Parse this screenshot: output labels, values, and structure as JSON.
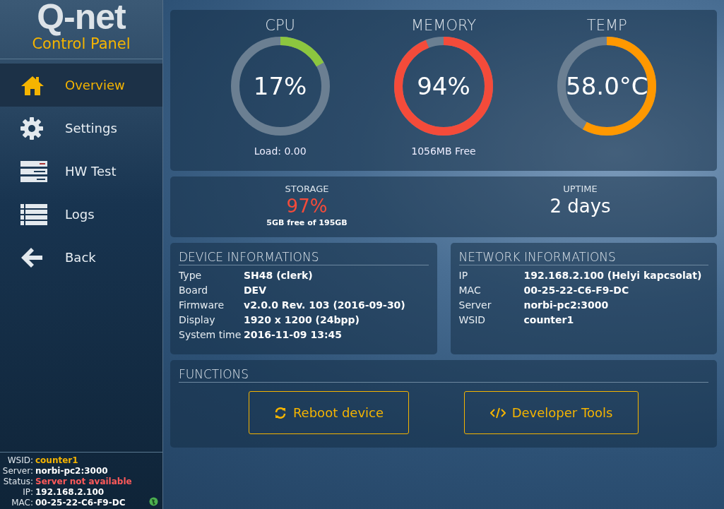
{
  "logo": {
    "brand": "Q-net",
    "subtitle": "Control Panel"
  },
  "nav": [
    {
      "label": "Overview",
      "kind": "home",
      "selected": true
    },
    {
      "label": "Settings",
      "kind": "gear",
      "selected": false
    },
    {
      "label": "HW Test",
      "kind": "server",
      "selected": false
    },
    {
      "label": "Logs",
      "kind": "list",
      "selected": false
    },
    {
      "label": "Back",
      "kind": "back",
      "selected": false
    }
  ],
  "status_info": [
    {
      "label": "WSID:",
      "value": "counter1",
      "color": "#f5b400"
    },
    {
      "label": "Server:",
      "value": "norbi-pc2:3000",
      "color": "#ffffff"
    },
    {
      "label": "Status:",
      "value": "Server not available",
      "color": "#ff5a5a"
    },
    {
      "label": "IP:",
      "value": "192.168.2.100",
      "color": "#ffffff"
    },
    {
      "label": "MAC:",
      "value": "00-25-22-C6-F9-DC",
      "color": "#ffffff"
    }
  ],
  "gauges": [
    {
      "title": "CPU",
      "value": "17%",
      "caption": "Load: 0.00",
      "level": 0.17,
      "color": "#8cc63f"
    },
    {
      "title": "MEMORY",
      "value": "94%",
      "caption": "1056MB Free",
      "level": 0.94,
      "color": "#f44b3a"
    },
    {
      "title": "TEMP",
      "value": "58.0°C",
      "level": 0.58,
      "color": "#ff9800"
    }
  ],
  "stats": [
    {
      "title": "STORAGE",
      "value": "97%",
      "caption": "5GB free of 195GB",
      "color": "#f44b3a"
    },
    {
      "title": "UPTIME",
      "value": "2 days",
      "color": "#ffffff"
    }
  ],
  "device_info": {
    "title": "DEVICE INFORMATIONS",
    "rows": [
      {
        "label": "Type",
        "value": "SH48 (clerk)"
      },
      {
        "label": "Board",
        "value": "DEV"
      },
      {
        "label": "Firmware",
        "value": "v2.0.0 Rev. 103 (2016-09-30)"
      },
      {
        "label": "Display",
        "value": "1920 x 1200 (24bpp)"
      },
      {
        "label": "System time",
        "value": "2016-11-09 13:45"
      }
    ]
  },
  "network_info": {
    "title": "NETWORK INFORMATIONS",
    "rows": [
      {
        "label": "IP",
        "value": "192.168.2.100 (Helyi kapcsolat)"
      },
      {
        "label": "MAC",
        "value": "00-25-22-C6-F9-DC"
      },
      {
        "label": "Server",
        "value": "norbi-pc2:3000"
      },
      {
        "label": "WSID",
        "value": "counter1"
      }
    ]
  },
  "functions": {
    "title": "FUNCTIONS",
    "buttons": [
      {
        "label": "Reboot device",
        "kind": "refresh"
      },
      {
        "label": "Developer Tools",
        "kind": "code"
      }
    ]
  }
}
